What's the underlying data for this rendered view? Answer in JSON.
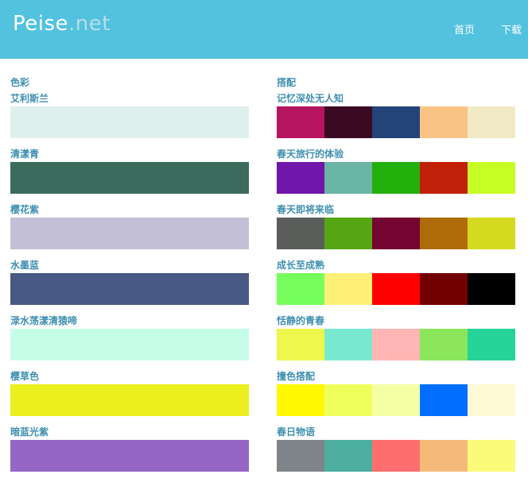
{
  "header": {
    "logo_main": "Peise",
    "logo_sub": ".net",
    "nav": [
      {
        "label": "首页"
      },
      {
        "label": "下载"
      }
    ]
  },
  "colors": {
    "section_title": "色彩",
    "items": [
      {
        "name": "艾利斯兰",
        "color": "#dfefee"
      },
      {
        "name": "清漾青",
        "color": "#3a6b5c"
      },
      {
        "name": "樱花紫",
        "color": "#c3bfd6"
      },
      {
        "name": "水墨蓝",
        "color": "#485a83"
      },
      {
        "name": "渌水荡漾清猿啼",
        "color": "#c5fde9"
      },
      {
        "name": "樱草色",
        "color": "#ebef1e"
      },
      {
        "name": "暗蓝光紫",
        "color": "#9566c6"
      }
    ]
  },
  "combos": {
    "section_title": "搭配",
    "items": [
      {
        "name": "记忆深处无人知",
        "colors": [
          "#b71460",
          "#3b0a22",
          "#234479",
          "#f8c484",
          "#f1eac4"
        ]
      },
      {
        "name": "春天旅行的体验",
        "colors": [
          "#7016ab",
          "#6bb5a6",
          "#24b00a",
          "#c11f07",
          "#c6fd25"
        ]
      },
      {
        "name": "春天即将来临",
        "colors": [
          "#5a5d5a",
          "#55a612",
          "#740530",
          "#ae6b08",
          "#d5da20"
        ]
      },
      {
        "name": "成长至成熟",
        "colors": [
          "#76ff5c",
          "#fff077",
          "#ff0000",
          "#720000",
          "#000000"
        ]
      },
      {
        "name": "恬静的青春",
        "colors": [
          "#eef74b",
          "#78e9d0",
          "#ffb6b4",
          "#8be65b",
          "#26d398"
        ]
      },
      {
        "name": "撞色搭配",
        "colors": [
          "#fff800",
          "#f1ff5c",
          "#f4ffa4",
          "#006fff",
          "#fff9d5"
        ]
      },
      {
        "name": "春日物语",
        "colors": [
          "#7e8489",
          "#4caf9f",
          "#ff6e6e",
          "#f5ba79",
          "#fbfb7a"
        ]
      }
    ]
  }
}
